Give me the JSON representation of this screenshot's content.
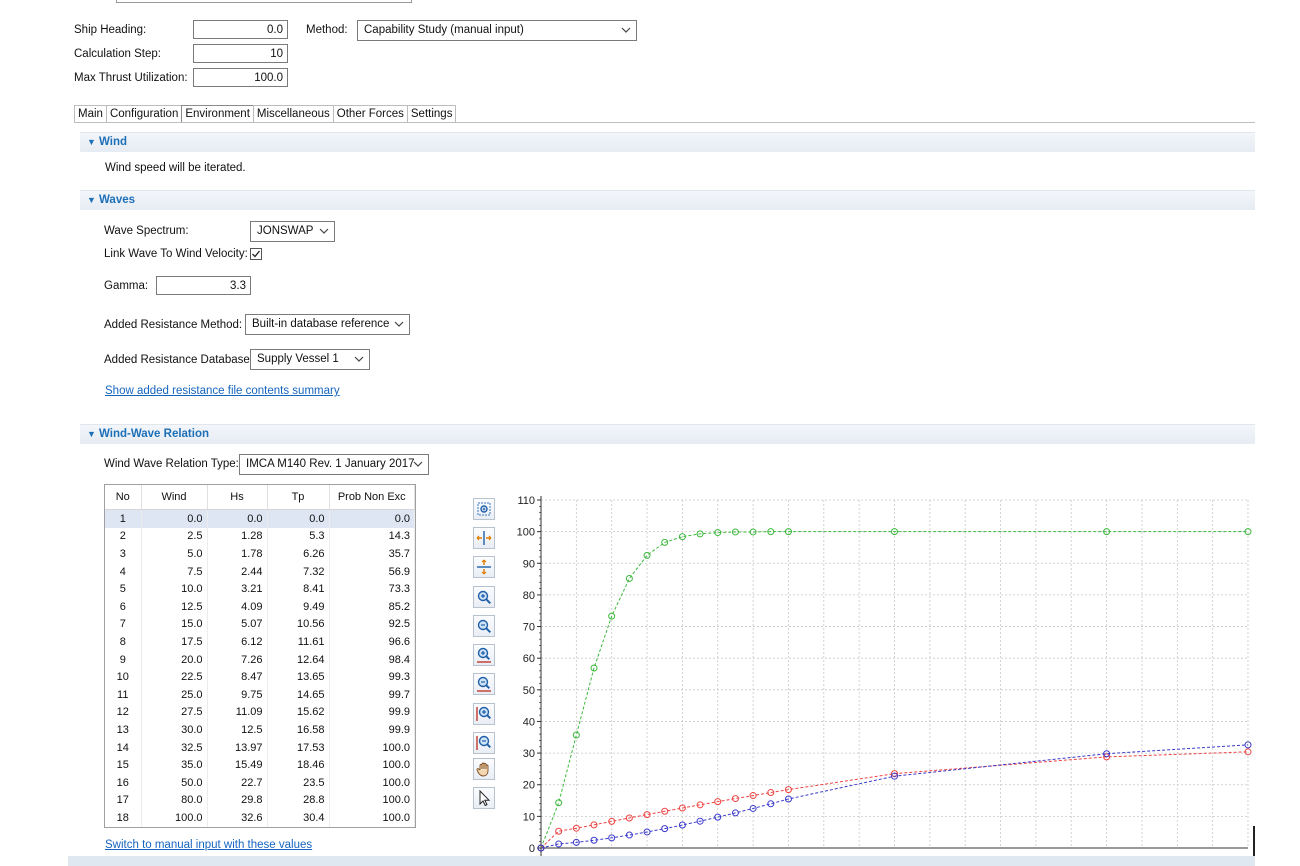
{
  "header": {
    "ship_heading_label": "Ship Heading:",
    "ship_heading_value": "0.0",
    "calc_step_label": "Calculation Step:",
    "calc_step_value": "10",
    "max_thrust_label": "Max Thrust Utilization:",
    "max_thrust_value": "100.0",
    "method_label": "Method:",
    "method_value": "Capability Study (manual input)"
  },
  "tabs": [
    {
      "label": "Main"
    },
    {
      "label": "Configuration"
    },
    {
      "label": "Environment",
      "active": true
    },
    {
      "label": "Miscellaneous"
    },
    {
      "label": "Other Forces"
    },
    {
      "label": "Settings"
    }
  ],
  "wind": {
    "title": "Wind",
    "text": "Wind speed will be iterated."
  },
  "waves": {
    "title": "Waves",
    "spectrum_label": "Wave Spectrum:",
    "spectrum_value": "JONSWAP",
    "link_label": "Link Wave To Wind Velocity:",
    "link_checked": true,
    "gamma_label": "Gamma:",
    "gamma_value": "3.3",
    "resist_method_label": "Added Resistance Method:",
    "resist_method_value": "Built-in database reference",
    "resist_db_label": "Added Resistance Database:",
    "resist_db_value": "Supply Vessel 1",
    "summary_link": "Show added resistance file contents summary"
  },
  "relation": {
    "title": "Wind-Wave Relation",
    "type_label": "Wind Wave Relation Type:",
    "type_value": "IMCA M140 Rev. 1 January 2017",
    "switch_link": "Switch to manual input with these values"
  },
  "table": {
    "columns": [
      "No",
      "Wind",
      "Hs",
      "Tp",
      "Prob Non Exc"
    ],
    "rows": [
      [
        "1",
        "0.0",
        "0.0",
        "0.0",
        "0.0"
      ],
      [
        "2",
        "2.5",
        "1.28",
        "5.3",
        "14.3"
      ],
      [
        "3",
        "5.0",
        "1.78",
        "6.26",
        "35.7"
      ],
      [
        "4",
        "7.5",
        "2.44",
        "7.32",
        "56.9"
      ],
      [
        "5",
        "10.0",
        "3.21",
        "8.41",
        "73.3"
      ],
      [
        "6",
        "12.5",
        "4.09",
        "9.49",
        "85.2"
      ],
      [
        "7",
        "15.0",
        "5.07",
        "10.56",
        "92.5"
      ],
      [
        "8",
        "17.5",
        "6.12",
        "11.61",
        "96.6"
      ],
      [
        "9",
        "20.0",
        "7.26",
        "12.64",
        "98.4"
      ],
      [
        "10",
        "22.5",
        "8.47",
        "13.65",
        "99.3"
      ],
      [
        "11",
        "25.0",
        "9.75",
        "14.65",
        "99.7"
      ],
      [
        "12",
        "27.5",
        "11.09",
        "15.62",
        "99.9"
      ],
      [
        "13",
        "30.0",
        "12.5",
        "16.58",
        "99.9"
      ],
      [
        "14",
        "32.5",
        "13.97",
        "17.53",
        "100.0"
      ],
      [
        "15",
        "35.0",
        "15.49",
        "18.46",
        "100.0"
      ],
      [
        "16",
        "50.0",
        "22.7",
        "23.5",
        "100.0"
      ],
      [
        "17",
        "80.0",
        "29.8",
        "28.8",
        "100.0"
      ],
      [
        "18",
        "100.0",
        "32.6",
        "30.4",
        "100.0"
      ]
    ]
  },
  "toolbar_icons": [
    "zoom-fit-icon",
    "fit-horizontal-icon",
    "fit-vertical-icon",
    "zoom-in-icon",
    "zoom-out-icon",
    "zoom-in-x-icon",
    "zoom-out-x-icon",
    "zoom-in-y-icon",
    "zoom-out-y-icon",
    "pan-hand-icon",
    "pointer-icon"
  ],
  "chart_data": {
    "type": "line",
    "y_ticks": [
      "0",
      "10",
      "20",
      "30",
      "40",
      "50",
      "60",
      "70",
      "80",
      "90",
      "100",
      "110"
    ],
    "ylim": [
      0,
      110
    ],
    "xlim": [
      0,
      100
    ],
    "grid": true,
    "series": [
      {
        "color": "#3cb83c",
        "x": [
          0,
          2.5,
          5,
          7.5,
          10,
          12.5,
          15,
          17.5,
          20,
          22.5,
          25,
          27.5,
          30,
          32.5,
          35,
          50,
          80,
          100
        ],
        "y": [
          0,
          14.3,
          35.7,
          56.9,
          73.3,
          85.2,
          92.5,
          96.6,
          98.4,
          99.3,
          99.7,
          99.9,
          99.9,
          100,
          100,
          100,
          100,
          100
        ]
      },
      {
        "color": "#ee4444",
        "x": [
          0,
          2.5,
          5,
          7.5,
          10,
          12.5,
          15,
          17.5,
          20,
          22.5,
          25,
          27.5,
          30,
          32.5,
          35,
          50,
          80,
          100
        ],
        "y": [
          0,
          5.3,
          6.26,
          7.32,
          8.41,
          9.49,
          10.56,
          11.61,
          12.64,
          13.65,
          14.65,
          15.62,
          16.58,
          17.53,
          18.46,
          23.5,
          28.8,
          30.4
        ]
      },
      {
        "color": "#3a3acc",
        "x": [
          0,
          2.5,
          5,
          7.5,
          10,
          12.5,
          15,
          17.5,
          20,
          22.5,
          25,
          27.5,
          30,
          32.5,
          35,
          50,
          80,
          100
        ],
        "y": [
          0,
          1.28,
          1.78,
          2.44,
          3.21,
          4.09,
          5.07,
          6.12,
          7.26,
          8.47,
          9.75,
          11.09,
          12.5,
          13.97,
          15.49,
          22.7,
          29.8,
          32.6
        ]
      }
    ]
  }
}
